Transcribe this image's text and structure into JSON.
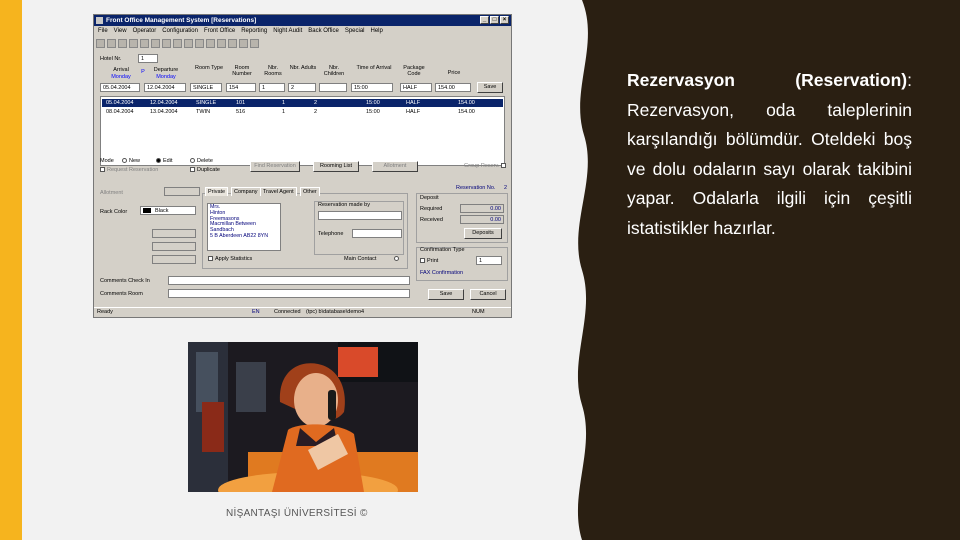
{
  "slide": {
    "heading_bold": "Rezervasyon (Reservation)",
    "body": ": Rezervasyon, oda taleplerinin karşılandığı bölümdür. Oteldeki boş ve dolu odaların sayı olarak takibini yapar. Odalarla ilgili için çeşitli istatistikler hazırlar.",
    "footer": "NİŞANTAŞI ÜNİVERSİTESİ ©",
    "colors": {
      "accent_yellow": "#f6b41e",
      "dark_panel": "#2a1f12",
      "title_bar": "#0a246a"
    }
  },
  "app": {
    "title": "Front Office Management System [Reservations]",
    "menu": [
      "File",
      "View",
      "Operator",
      "Configuration",
      "Front Office",
      "Reporting",
      "Night Audit",
      "Back Office",
      "Special",
      "Help"
    ],
    "hotel_label": "Hotel Nr.",
    "hotel_value": "1",
    "col_labels": [
      "Arrival",
      "Departure",
      "Room Type",
      "Room Number",
      "Nbr. Rooms",
      "Nbr. Adults",
      "Nbr. Children",
      "Time of Arrival",
      "Package Code",
      "Price"
    ],
    "day_labels": [
      "Monday",
      "Monday"
    ],
    "p_label": "P",
    "input_row": [
      "05.04.2004",
      "12.04.2004",
      "SINGLE",
      "154",
      "1",
      "2",
      "",
      "15:00",
      "HALF",
      "154.00"
    ],
    "save_label": "Save",
    "rows": [
      [
        "05.04.2004",
        "12.04.2004",
        "SINGLE",
        "101",
        "1",
        "2",
        "15:00",
        "HALF",
        "154.00"
      ],
      [
        "08.04.2004",
        "13.04.2004",
        "TWIN",
        "516",
        "1",
        "2",
        "15:00",
        "HALF",
        "154.00"
      ]
    ],
    "mode_label": "Mode",
    "mode_options": [
      "New",
      "Edit",
      "Delete"
    ],
    "request_label": "Request Reservation",
    "duplicate_label": "Duplicate",
    "btn_find": "Find Reservation",
    "btn_rooming": "Rooming List",
    "btn_allotment": "Allotment",
    "group_label": "Group Reserv.",
    "allotment_label": "Allotment",
    "rack_color_label": "Rack Color",
    "rack_color_value": "Black",
    "tabs": [
      "Private",
      "Company",
      "Travel Agent",
      "Other"
    ],
    "private_list": [
      "Mrs.",
      "Hinton",
      "Freemasons",
      "Macmillan Between",
      "Sandbach",
      "5 B Aberdeen AB22 8YN"
    ],
    "reservation_made_by_label": "Reservation made by",
    "telephone_label": "Telephone",
    "reservation_no_label": "Reservation No.",
    "reservation_no_value": "2",
    "deposit_label": "Deposit",
    "required_label": "Required",
    "required_value": "0.00",
    "received_label": "Received",
    "received_value": "0.00",
    "deposits_btn": "Deposits",
    "confirmation_label": "Confirmation Type",
    "print_label": "Print",
    "print_copies": "1",
    "fax_label": "FAX Confirmation",
    "apply_stats_label": "Apply Statistics",
    "main_contact_label": "Main Contact",
    "comments_checkin_label": "Comments Check In",
    "comments_room_label": "Comments Room",
    "btn_save": "Save",
    "btn_cancel": "Cancel",
    "status": [
      "Ready",
      "EN",
      "Connected",
      "(tpc) b\\database\\demo4",
      "NUM"
    ]
  }
}
